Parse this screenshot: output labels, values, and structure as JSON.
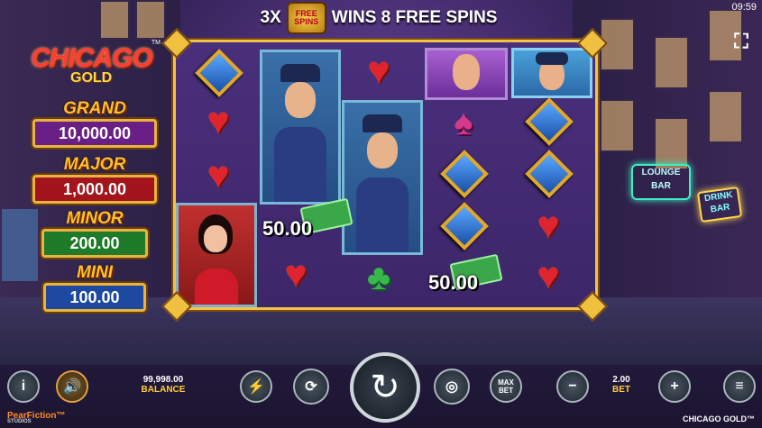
{
  "status": {
    "clock": "09:59"
  },
  "banner": {
    "prefix": "3X",
    "badge_top": "FREE",
    "badge_bottom": "SPINS",
    "text": "WINS 8 FREE SPINS"
  },
  "logo": {
    "line1": "CHICAGO",
    "line2": "GOLD",
    "tm": "TM"
  },
  "jackpots": [
    {
      "label": "GRAND",
      "value": "10,000.00",
      "color": "#6a1f86"
    },
    {
      "label": "MAJOR",
      "value": "1,000.00",
      "color": "#a3141c"
    },
    {
      "label": "MINOR",
      "value": "200.00",
      "color": "#1f7a2a"
    },
    {
      "label": "MINI",
      "value": "100.00",
      "color": "#1d4aa0"
    }
  ],
  "reels": {
    "cash_values": [
      "50.00",
      "50.00"
    ]
  },
  "controls": {
    "balance_value": "99,998.00",
    "balance_label": "BALANCE",
    "bet_value": "2.00",
    "bet_label": "BET",
    "max_bet_line1": "MAX",
    "max_bet_line2": "BET",
    "info_glyph": "i",
    "plus_glyph": "+",
    "minus_glyph": "−"
  },
  "footer": {
    "studio": "PearFiction™",
    "studio_sub": "STUDIOS",
    "game_name": "CHICAGO GOLD™"
  }
}
